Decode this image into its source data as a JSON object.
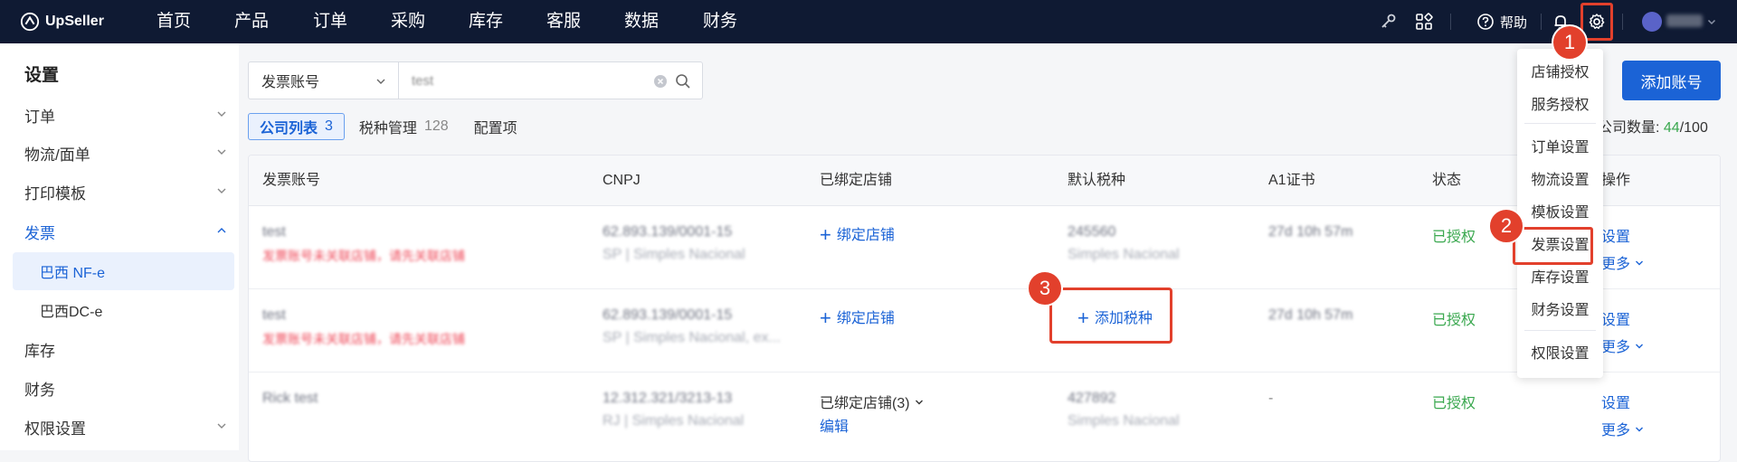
{
  "topbar": {
    "brand": "UpSeller",
    "nav": [
      "首页",
      "产品",
      "订单",
      "采购",
      "库存",
      "客服",
      "数据",
      "财务"
    ],
    "help_label": "帮助",
    "icons": [
      "key-icon",
      "apps-grid-icon",
      "help-circle-icon",
      "bell-icon",
      "gear-icon",
      "avatar-icon",
      "chevron-down-icon"
    ]
  },
  "sidebar": {
    "title": "设置",
    "items": [
      {
        "label": "订单",
        "expandable": true
      },
      {
        "label": "物流/面单",
        "expandable": true
      },
      {
        "label": "打印模板",
        "expandable": true
      },
      {
        "label": "发票",
        "expandable": true,
        "expanded": true
      },
      {
        "label": "库存",
        "expandable": false
      },
      {
        "label": "财务",
        "expandable": false
      },
      {
        "label": "权限设置",
        "expandable": true
      }
    ],
    "sub_items": [
      {
        "label": "巴西 NF-e",
        "selected": true
      },
      {
        "label": "巴西DC-e",
        "selected": false
      }
    ]
  },
  "search": {
    "field_select": "发票账号",
    "value": "test"
  },
  "tabs": [
    {
      "label": "公司列表",
      "count": "3",
      "active": true
    },
    {
      "label": "税种管理",
      "count": "128",
      "active": false
    },
    {
      "label": "配置项",
      "count": "",
      "active": false
    }
  ],
  "actions": {
    "add_account": "添加账号"
  },
  "company_count": {
    "label": "公司数量:",
    "used": "44",
    "total": "/100"
  },
  "table": {
    "headers": [
      "发票账号",
      "CNPJ",
      "已绑定店铺",
      "默认税种",
      "A1证书",
      "状态",
      "操作"
    ],
    "rows": [
      {
        "account": "test",
        "account_warning": "发票账号未关联店铺，请先关联店铺",
        "cnpj": "62.893.139/0001-15",
        "cnpj_sub": "SP | Simples Nacional",
        "store": "绑定店铺",
        "tax": "245560",
        "tax_sub": "Simples Nacional",
        "cert": "27d 10h 57m",
        "status": "已授权",
        "op_primary": "设置",
        "op_more": "更多"
      },
      {
        "account": "test",
        "account_warning": "发票账号未关联店铺，请先关联店铺",
        "cnpj": "62.893.139/0001-15",
        "cnpj_sub": "SP | Simples Nacional, ex...",
        "store": "绑定店铺",
        "tax": "添加税种",
        "tax_sub": "",
        "cert": "27d 10h 57m",
        "status": "已授权",
        "op_primary": "设置",
        "op_more": "更多"
      },
      {
        "account": "Rick test",
        "account_warning": "",
        "cnpj": "12.312.321/3213-13",
        "cnpj_sub": "RJ | Simples Nacional",
        "store": "已绑定店铺(3)",
        "store_edit": "编辑",
        "tax": "427892",
        "tax_sub": "Simples Nacional",
        "cert": "-",
        "status": "已授权",
        "op_primary": "设置",
        "op_more": "更多"
      }
    ]
  },
  "settings_menu": {
    "groups": [
      [
        "店铺授权",
        "服务授权"
      ],
      [
        "订单设置",
        "物流设置",
        "模板设置",
        "发票设置",
        "库存设置",
        "财务设置"
      ],
      [
        "权限设置"
      ]
    ]
  },
  "callouts": [
    "1",
    "2",
    "3"
  ],
  "colors": {
    "topbar": "#0f1a33",
    "primary": "#1b63d6",
    "success": "#3aa84f",
    "danger": "#ef4a5a",
    "callout": "#e2402c"
  }
}
